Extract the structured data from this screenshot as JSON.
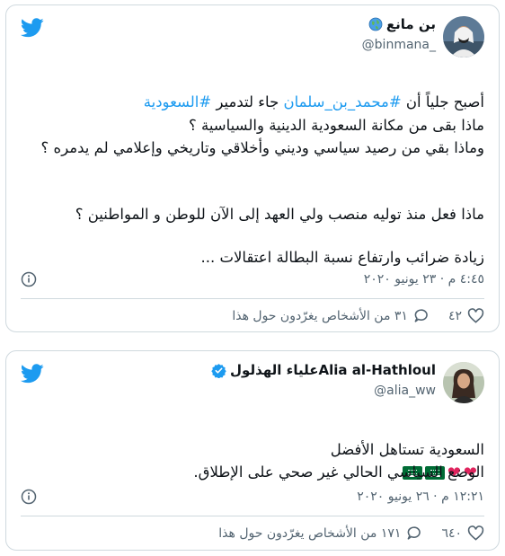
{
  "tweets": [
    {
      "display_name": "بن مانع",
      "handle": "@binmana_",
      "body_plain_1": "أصبح جلياً  أن ",
      "hashtag_1": "#محمد_بن_سلمان",
      "body_plain_2": " جاء لتدمير ",
      "hashtag_2": "#السعودية",
      "paragraph_2": "ماذا بقى من مكانة السعودية الدينية والسياسية ؟\nوماذا بقي من رصيد سياسي وديني وأخلاقي وتاريخي وإعلامي لم يدمره ؟",
      "paragraph_3": "ماذا فعل منذ توليه منصب ولي العهد إلى الآن للوطن و المواطنين ؟",
      "paragraph_4": "زيادة ضرائب وارتفاع نسبة البطالة اعتقالات ...",
      "timestamp": "٤:٤٥ م · ٢٣ يونيو ٢٠٢٠",
      "likes": "٤٢",
      "talking": "٣١ من الأشخاص يغرّدون حول هذا"
    },
    {
      "display_name": "Alia al-Hathloulعلياء الهذلول",
      "handle": "@alia_ww",
      "paragraph_1": "السعودية تستاهل الأفضل",
      "paragraph_2": "الوضع السياسي الحالي غير صحي على الإطلاق.",
      "timestamp": "١٢:٢١ م · ٢٦ يونيو ٢٠٢٠",
      "likes": "٦٤٠",
      "talking": "١٧١ من الأشخاص يغرّدون حول هذا"
    }
  ],
  "colors": {
    "twitter_blue": "#1d9bf0",
    "secondary_text": "#536471",
    "border": "#cfd9de",
    "verified": "#1d9bf0",
    "heart": "#e0245e"
  },
  "icons": [
    "twitter-bird-icon",
    "globe-icon",
    "verified-badge-icon",
    "info-icon",
    "heart-icon",
    "reply-bubble-icon"
  ]
}
